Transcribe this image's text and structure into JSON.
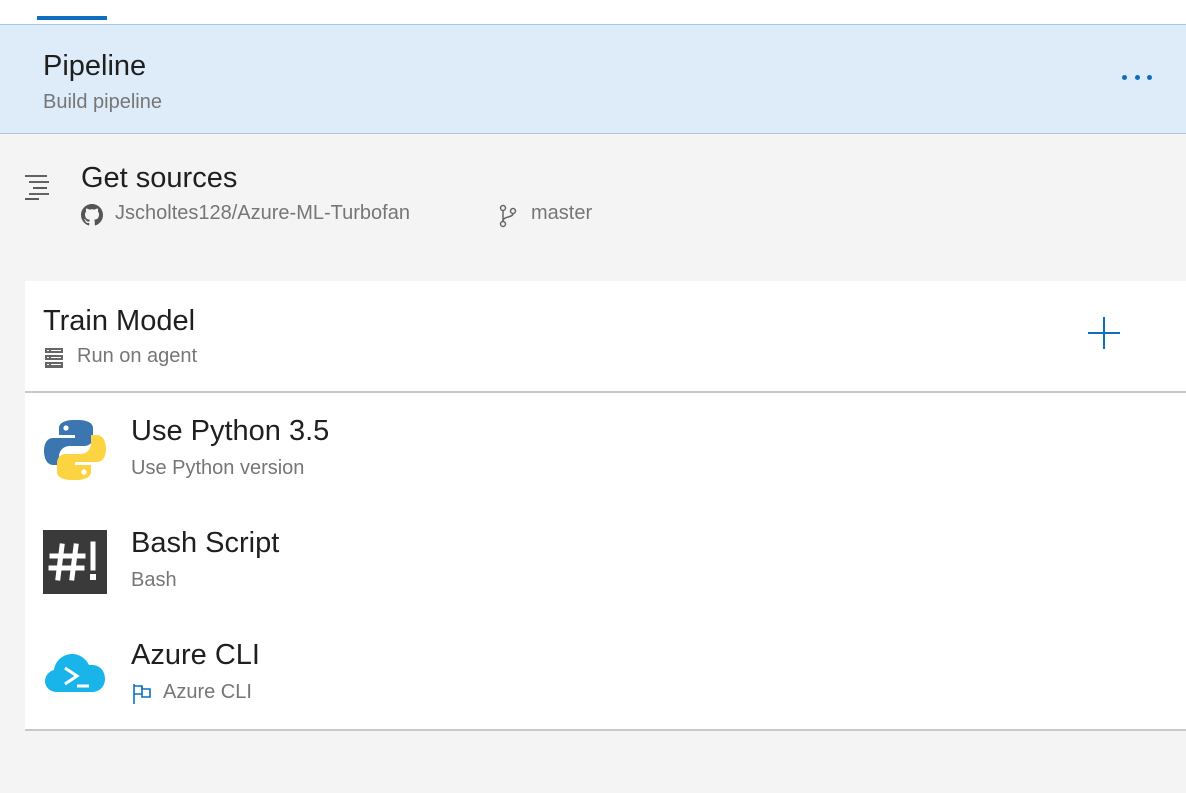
{
  "pipeline": {
    "title": "Pipeline",
    "subtitle": "Build pipeline",
    "more_icon": "more-ellipsis-icon"
  },
  "sources": {
    "title": "Get sources",
    "icon": "sources-list-icon",
    "repo_icon": "github-icon",
    "repo": "Jscholtes128/Azure-ML-Turbofan",
    "branch_icon": "branch-icon",
    "branch": "master"
  },
  "job": {
    "title": "Train Model",
    "agent_icon": "server-icon",
    "agent": "Run on agent",
    "add_icon": "plus-icon",
    "tasks": [
      {
        "title": "Use Python 3.5",
        "subtitle": "Use Python version",
        "icon": "python-icon"
      },
      {
        "title": "Bash Script",
        "subtitle": "Bash",
        "icon": "bash-icon"
      },
      {
        "title": "Azure CLI",
        "subtitle": "Azure CLI",
        "icon": "azure-cli-icon",
        "flag_icon": "flag-icon"
      }
    ]
  },
  "colors": {
    "accent": "#106ebe",
    "header_bg": "#deecf9",
    "page_bg": "#f4f4f4",
    "text_primary": "#1f1f1f",
    "text_secondary": "#767676"
  }
}
